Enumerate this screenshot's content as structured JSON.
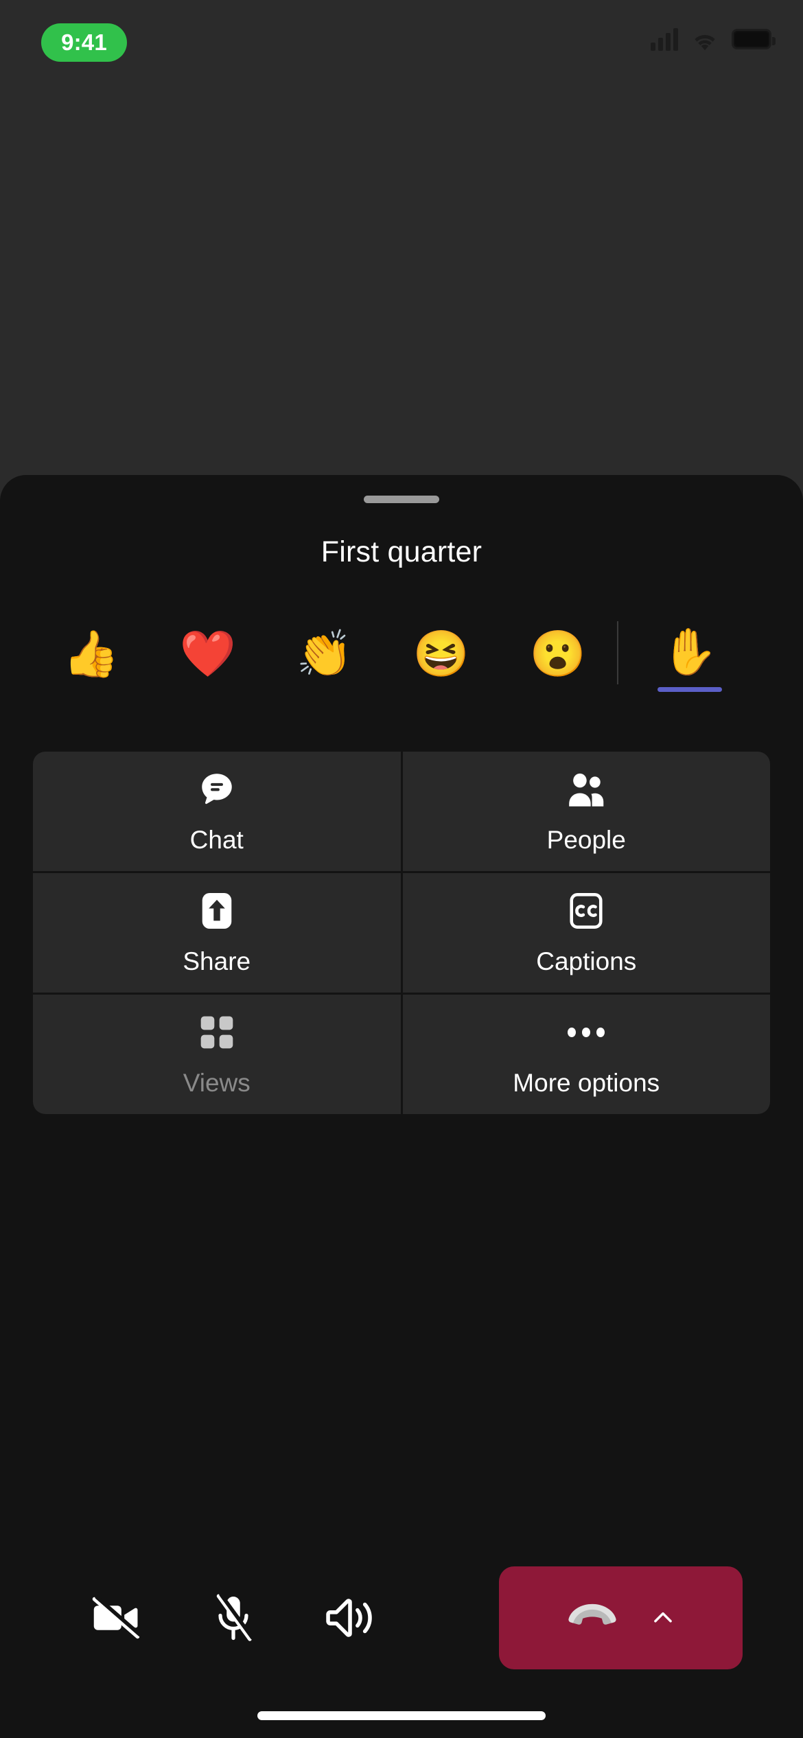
{
  "status_bar": {
    "time": "9:41",
    "time_pill_color": "#31C14B",
    "icons": [
      "cellular-signal-icon",
      "wifi-icon",
      "battery-icon"
    ]
  },
  "sheet": {
    "title": "First quarter",
    "grabber": "drag-handle",
    "background_color": "#131313"
  },
  "reactions": {
    "items": [
      {
        "name": "like",
        "glyph": "👍"
      },
      {
        "name": "heart",
        "glyph": "❤️"
      },
      {
        "name": "applause",
        "glyph": "👏"
      },
      {
        "name": "laugh",
        "glyph": "😆"
      },
      {
        "name": "surprised",
        "glyph": "😮"
      }
    ],
    "raise_hand": {
      "name": "raise-hand",
      "glyph": "✋",
      "active": true,
      "indicator_color": "#5B5FC7"
    }
  },
  "action_grid": [
    {
      "label": "Chat",
      "icon": "chat-bubble-icon",
      "disabled": false
    },
    {
      "label": "People",
      "icon": "people-icon",
      "disabled": false
    },
    {
      "label": "Share",
      "icon": "share-upload-icon",
      "disabled": false
    },
    {
      "label": "Captions",
      "icon": "closed-captions-icon",
      "disabled": false
    },
    {
      "label": "Views",
      "icon": "grid-views-icon",
      "disabled": true
    },
    {
      "label": "More options",
      "icon": "ellipsis-icon",
      "disabled": false
    }
  ],
  "call_bar": {
    "camera": {
      "name": "camera-off-icon",
      "state": "off"
    },
    "mic": {
      "name": "microphone-off-icon",
      "state": "muted"
    },
    "speaker": {
      "name": "speaker-on-icon",
      "state": "on"
    },
    "hangup": {
      "name": "hang-up-button",
      "color": "#8E1838",
      "chevron": "chevron-up-icon"
    }
  },
  "home_indicator": "home-indicator"
}
